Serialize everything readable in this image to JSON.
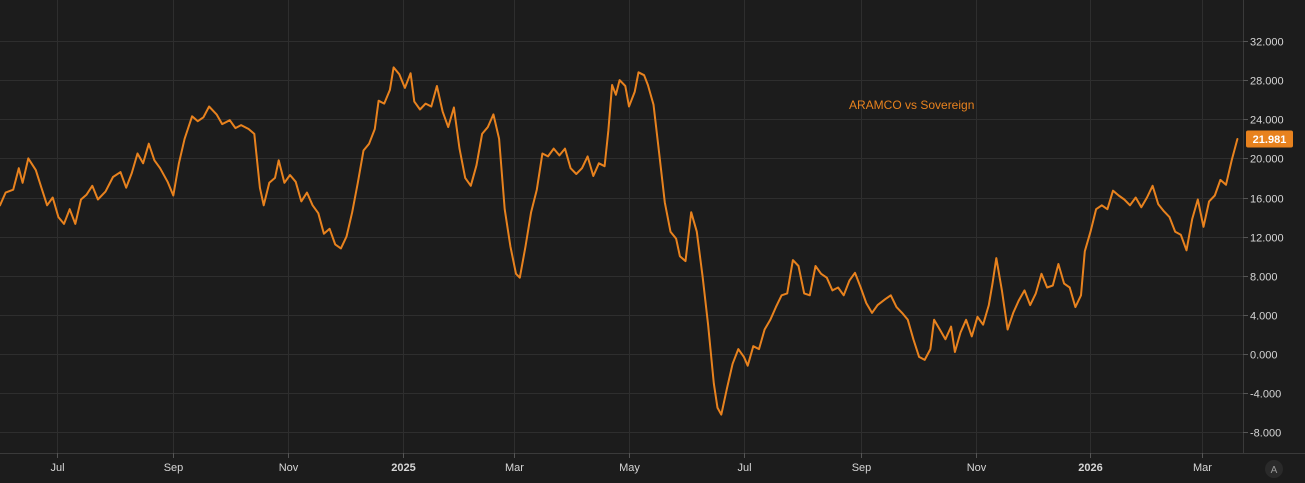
{
  "chart_data": {
    "type": "line",
    "title": "",
    "legend": "ARAMCO vs Sovereign",
    "last_value_label": "21.981",
    "auto_scale_label": "A",
    "colors": {
      "background": "#1c1c1c",
      "grid": "#2e2e2e",
      "line": "#e8821e",
      "text": "#d6d6d6"
    },
    "ylim": [
      -10,
      36
    ],
    "grid": true,
    "y_ticks": [
      {
        "value": 32,
        "label": "32.000"
      },
      {
        "value": 28,
        "label": "28.000"
      },
      {
        "value": 24,
        "label": "24.000"
      },
      {
        "value": 20,
        "label": "20.000"
      },
      {
        "value": 16,
        "label": "16.000"
      },
      {
        "value": 12,
        "label": "12.000"
      },
      {
        "value": 8,
        "label": "8.000"
      },
      {
        "value": 4,
        "label": "4.000"
      },
      {
        "value": 0,
        "label": "0.000"
      },
      {
        "value": -4,
        "label": "-4.000"
      },
      {
        "value": -8,
        "label": "-8.000"
      }
    ],
    "x_range": [
      "2024-06-01",
      "2026-03-23"
    ],
    "x_ticks": [
      {
        "date": "2024-07-01",
        "label": "Jul",
        "bold": false
      },
      {
        "date": "2024-09-01",
        "label": "Sep",
        "bold": false
      },
      {
        "date": "2024-11-01",
        "label": "Nov",
        "bold": false
      },
      {
        "date": "2025-01-01",
        "label": "2025",
        "bold": true
      },
      {
        "date": "2025-03-01",
        "label": "Mar",
        "bold": false
      },
      {
        "date": "2025-05-01",
        "label": "May",
        "bold": false
      },
      {
        "date": "2025-07-01",
        "label": "Jul",
        "bold": false
      },
      {
        "date": "2025-09-01",
        "label": "Sep",
        "bold": false
      },
      {
        "date": "2025-11-01",
        "label": "Nov",
        "bold": false
      },
      {
        "date": "2026-01-01",
        "label": "2026",
        "bold": true
      },
      {
        "date": "2026-03-01",
        "label": "Mar",
        "bold": false
      }
    ],
    "series": [
      {
        "values": [
          [
            "2024-06-01",
            15.2
          ],
          [
            "2024-06-04",
            16.5
          ],
          [
            "2024-06-08",
            16.8
          ],
          [
            "2024-06-11",
            19.0
          ],
          [
            "2024-06-13",
            17.5
          ],
          [
            "2024-06-16",
            20.0
          ],
          [
            "2024-06-20",
            18.8
          ],
          [
            "2024-06-23",
            17.0
          ],
          [
            "2024-06-26",
            15.2
          ],
          [
            "2024-06-29",
            16.0
          ],
          [
            "2024-07-02",
            14.0
          ],
          [
            "2024-07-05",
            13.3
          ],
          [
            "2024-07-08",
            14.8
          ],
          [
            "2024-07-11",
            13.3
          ],
          [
            "2024-07-14",
            15.8
          ],
          [
            "2024-07-17",
            16.3
          ],
          [
            "2024-07-20",
            17.2
          ],
          [
            "2024-07-23",
            15.8
          ],
          [
            "2024-07-27",
            16.6
          ],
          [
            "2024-07-31",
            18.1
          ],
          [
            "2024-08-04",
            18.6
          ],
          [
            "2024-08-07",
            17.0
          ],
          [
            "2024-08-10",
            18.5
          ],
          [
            "2024-08-13",
            20.5
          ],
          [
            "2024-08-16",
            19.5
          ],
          [
            "2024-08-19",
            21.5
          ],
          [
            "2024-08-22",
            19.8
          ],
          [
            "2024-08-25",
            19.0
          ],
          [
            "2024-08-29",
            17.6
          ],
          [
            "2024-09-01",
            16.2
          ],
          [
            "2024-09-04",
            19.5
          ],
          [
            "2024-09-07",
            22.0
          ],
          [
            "2024-09-11",
            24.3
          ],
          [
            "2024-09-14",
            23.8
          ],
          [
            "2024-09-17",
            24.2
          ],
          [
            "2024-09-20",
            25.3
          ],
          [
            "2024-09-24",
            24.5
          ],
          [
            "2024-09-27",
            23.5
          ],
          [
            "2024-10-01",
            23.9
          ],
          [
            "2024-10-04",
            23.1
          ],
          [
            "2024-10-07",
            23.4
          ],
          [
            "2024-10-11",
            23.0
          ],
          [
            "2024-10-14",
            22.5
          ],
          [
            "2024-10-17",
            17.0
          ],
          [
            "2024-10-19",
            15.2
          ],
          [
            "2024-10-22",
            17.5
          ],
          [
            "2024-10-25",
            18.0
          ],
          [
            "2024-10-27",
            19.8
          ],
          [
            "2024-10-30",
            17.5
          ],
          [
            "2024-11-02",
            18.3
          ],
          [
            "2024-11-05",
            17.6
          ],
          [
            "2024-11-08",
            15.6
          ],
          [
            "2024-11-11",
            16.5
          ],
          [
            "2024-11-14",
            15.2
          ],
          [
            "2024-11-17",
            14.4
          ],
          [
            "2024-11-20",
            12.3
          ],
          [
            "2024-11-23",
            12.8
          ],
          [
            "2024-11-26",
            11.2
          ],
          [
            "2024-11-29",
            10.8
          ],
          [
            "2024-12-02",
            12.0
          ],
          [
            "2024-12-05",
            14.5
          ],
          [
            "2024-12-08",
            17.5
          ],
          [
            "2024-12-11",
            20.8
          ],
          [
            "2024-12-14",
            21.5
          ],
          [
            "2024-12-17",
            23.0
          ],
          [
            "2024-12-19",
            25.9
          ],
          [
            "2024-12-22",
            25.6
          ],
          [
            "2024-12-25",
            27.0
          ],
          [
            "2024-12-27",
            29.3
          ],
          [
            "2024-12-30",
            28.6
          ],
          [
            "2025-01-02",
            27.2
          ],
          [
            "2025-01-05",
            28.7
          ],
          [
            "2025-01-07",
            25.8
          ],
          [
            "2025-01-10",
            25.0
          ],
          [
            "2025-01-13",
            25.6
          ],
          [
            "2025-01-16",
            25.3
          ],
          [
            "2025-01-19",
            27.4
          ],
          [
            "2025-01-22",
            24.8
          ],
          [
            "2025-01-25",
            23.2
          ],
          [
            "2025-01-28",
            25.2
          ],
          [
            "2025-01-31",
            21.0
          ],
          [
            "2025-02-03",
            18.0
          ],
          [
            "2025-02-06",
            17.2
          ],
          [
            "2025-02-09",
            19.3
          ],
          [
            "2025-02-12",
            22.5
          ],
          [
            "2025-02-15",
            23.2
          ],
          [
            "2025-02-18",
            24.5
          ],
          [
            "2025-02-21",
            22.0
          ],
          [
            "2025-02-24",
            14.8
          ],
          [
            "2025-02-27",
            11.0
          ],
          [
            "2025-03-02",
            8.2
          ],
          [
            "2025-03-04",
            7.8
          ],
          [
            "2025-03-07",
            11.0
          ],
          [
            "2025-03-10",
            14.5
          ],
          [
            "2025-03-13",
            16.8
          ],
          [
            "2025-03-16",
            20.5
          ],
          [
            "2025-03-19",
            20.2
          ],
          [
            "2025-03-22",
            21.0
          ],
          [
            "2025-03-25",
            20.3
          ],
          [
            "2025-03-28",
            21.0
          ],
          [
            "2025-03-31",
            19.0
          ],
          [
            "2025-04-03",
            18.4
          ],
          [
            "2025-04-06",
            19.0
          ],
          [
            "2025-04-09",
            20.2
          ],
          [
            "2025-04-12",
            18.2
          ],
          [
            "2025-04-15",
            19.5
          ],
          [
            "2025-04-18",
            19.2
          ],
          [
            "2025-04-20",
            22.8
          ],
          [
            "2025-04-22",
            27.5
          ],
          [
            "2025-04-24",
            26.5
          ],
          [
            "2025-04-26",
            28.0
          ],
          [
            "2025-04-29",
            27.4
          ],
          [
            "2025-05-01",
            25.3
          ],
          [
            "2025-05-04",
            26.8
          ],
          [
            "2025-05-06",
            28.8
          ],
          [
            "2025-05-09",
            28.5
          ],
          [
            "2025-05-11",
            27.5
          ],
          [
            "2025-05-14",
            25.5
          ],
          [
            "2025-05-17",
            20.5
          ],
          [
            "2025-05-20",
            15.5
          ],
          [
            "2025-05-23",
            12.5
          ],
          [
            "2025-05-26",
            11.8
          ],
          [
            "2025-05-28",
            10.0
          ],
          [
            "2025-05-31",
            9.5
          ],
          [
            "2025-06-03",
            14.5
          ],
          [
            "2025-06-06",
            12.5
          ],
          [
            "2025-06-09",
            8.0
          ],
          [
            "2025-06-12",
            3.0
          ],
          [
            "2025-06-15",
            -3.0
          ],
          [
            "2025-06-17",
            -5.5
          ],
          [
            "2025-06-19",
            -6.2
          ],
          [
            "2025-06-22",
            -3.5
          ],
          [
            "2025-06-25",
            -1.0
          ],
          [
            "2025-06-28",
            0.5
          ],
          [
            "2025-07-01",
            -0.3
          ],
          [
            "2025-07-03",
            -1.2
          ],
          [
            "2025-07-06",
            0.8
          ],
          [
            "2025-07-09",
            0.5
          ],
          [
            "2025-07-12",
            2.5
          ],
          [
            "2025-07-15",
            3.5
          ],
          [
            "2025-07-18",
            4.8
          ],
          [
            "2025-07-21",
            6.0
          ],
          [
            "2025-07-24",
            6.2
          ],
          [
            "2025-07-27",
            9.6
          ],
          [
            "2025-07-30",
            9.0
          ],
          [
            "2025-08-02",
            6.2
          ],
          [
            "2025-08-05",
            6.0
          ],
          [
            "2025-08-08",
            9.0
          ],
          [
            "2025-08-11",
            8.2
          ],
          [
            "2025-08-14",
            7.8
          ],
          [
            "2025-08-17",
            6.5
          ],
          [
            "2025-08-20",
            6.8
          ],
          [
            "2025-08-23",
            6.0
          ],
          [
            "2025-08-26",
            7.5
          ],
          [
            "2025-08-29",
            8.3
          ],
          [
            "2025-09-01",
            6.8
          ],
          [
            "2025-09-04",
            5.2
          ],
          [
            "2025-09-07",
            4.2
          ],
          [
            "2025-09-10",
            5.0
          ],
          [
            "2025-09-14",
            5.6
          ],
          [
            "2025-09-17",
            6.0
          ],
          [
            "2025-09-20",
            4.8
          ],
          [
            "2025-09-23",
            4.2
          ],
          [
            "2025-09-26",
            3.5
          ],
          [
            "2025-09-29",
            1.5
          ],
          [
            "2025-10-02",
            -0.3
          ],
          [
            "2025-10-05",
            -0.6
          ],
          [
            "2025-10-08",
            0.5
          ],
          [
            "2025-10-10",
            3.5
          ],
          [
            "2025-10-13",
            2.5
          ],
          [
            "2025-10-16",
            1.5
          ],
          [
            "2025-10-19",
            2.8
          ],
          [
            "2025-10-21",
            0.2
          ],
          [
            "2025-10-24",
            2.2
          ],
          [
            "2025-10-27",
            3.5
          ],
          [
            "2025-10-30",
            1.8
          ],
          [
            "2025-11-02",
            3.8
          ],
          [
            "2025-11-05",
            3.0
          ],
          [
            "2025-11-08",
            5.0
          ],
          [
            "2025-11-10",
            7.2
          ],
          [
            "2025-11-12",
            9.8
          ],
          [
            "2025-11-15",
            6.5
          ],
          [
            "2025-11-18",
            2.5
          ],
          [
            "2025-11-21",
            4.2
          ],
          [
            "2025-11-24",
            5.5
          ],
          [
            "2025-11-27",
            6.5
          ],
          [
            "2025-11-30",
            5.0
          ],
          [
            "2025-12-03",
            6.2
          ],
          [
            "2025-12-06",
            8.2
          ],
          [
            "2025-12-09",
            6.8
          ],
          [
            "2025-12-12",
            7.0
          ],
          [
            "2025-12-15",
            9.2
          ],
          [
            "2025-12-18",
            7.2
          ],
          [
            "2025-12-21",
            6.8
          ],
          [
            "2025-12-24",
            4.8
          ],
          [
            "2025-12-27",
            6.0
          ],
          [
            "2025-12-29",
            10.5
          ],
          [
            "2026-01-01",
            12.5
          ],
          [
            "2026-01-04",
            14.8
          ],
          [
            "2026-01-07",
            15.2
          ],
          [
            "2026-01-10",
            14.8
          ],
          [
            "2026-01-13",
            16.7
          ],
          [
            "2026-01-16",
            16.2
          ],
          [
            "2026-01-19",
            15.8
          ],
          [
            "2026-01-22",
            15.2
          ],
          [
            "2026-01-25",
            16.0
          ],
          [
            "2026-01-28",
            15.0
          ],
          [
            "2026-01-31",
            16.0
          ],
          [
            "2026-02-03",
            17.2
          ],
          [
            "2026-02-06",
            15.3
          ],
          [
            "2026-02-09",
            14.6
          ],
          [
            "2026-02-12",
            14.0
          ],
          [
            "2026-02-15",
            12.5
          ],
          [
            "2026-02-18",
            12.2
          ],
          [
            "2026-02-21",
            10.6
          ],
          [
            "2026-02-24",
            13.8
          ],
          [
            "2026-02-27",
            15.8
          ],
          [
            "2026-03-02",
            13.0
          ],
          [
            "2026-03-05",
            15.6
          ],
          [
            "2026-03-08",
            16.2
          ],
          [
            "2026-03-11",
            17.8
          ],
          [
            "2026-03-14",
            17.3
          ],
          [
            "2026-03-17",
            19.8
          ],
          [
            "2026-03-20",
            21.98
          ]
        ]
      }
    ]
  }
}
